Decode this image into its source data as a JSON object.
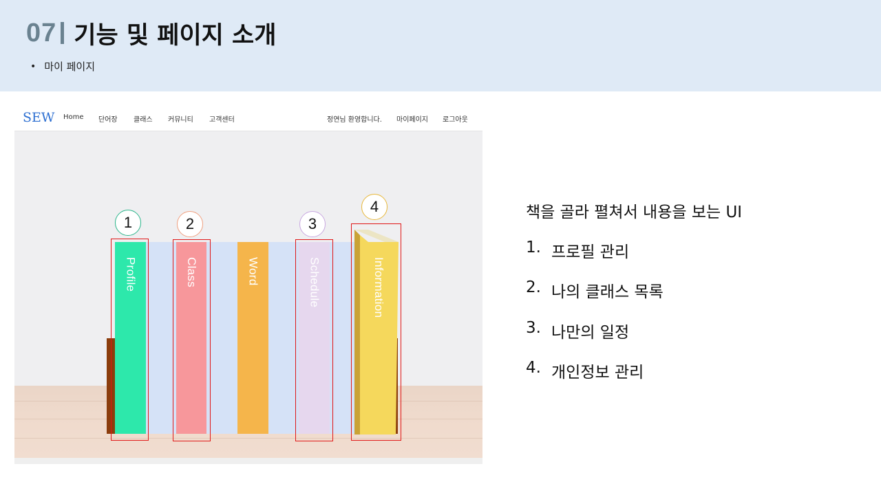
{
  "slide": {
    "number": "07",
    "title": "기능 및 페이지 소개",
    "subtitle": "마이 페이지"
  },
  "screenshot": {
    "logo": "SEW",
    "nav_left": [
      "Home",
      "단어장",
      "클래스",
      "커뮤니티",
      "고객센터"
    ],
    "nav_right": [
      "정연님 환영합니다.",
      "마이페이지",
      "로그아웃"
    ],
    "books": [
      {
        "label": "Profile",
        "color": "#2de8ab"
      },
      {
        "label": "Class",
        "color": "#f7979b"
      },
      {
        "label": "Word",
        "color": "#f5b54b"
      },
      {
        "label": "Schedule",
        "color": "#e6d7ee"
      },
      {
        "label": "Information",
        "color": "#f5d85c"
      }
    ],
    "markers": [
      {
        "number": "1",
        "color": "#2ab58a"
      },
      {
        "number": "2",
        "color": "#f0a080"
      },
      {
        "number": "3",
        "color": "#c9a8e0"
      },
      {
        "number": "4",
        "color": "#e8b83a"
      }
    ],
    "highlight_color": "#e01515"
  },
  "description": {
    "heading": "책을 골라 펼쳐서 내용을 보는 UI",
    "items": [
      {
        "number": "1.",
        "text": "프로필 관리"
      },
      {
        "number": "2.",
        "text": "나의 클래스 목록"
      },
      {
        "number": "3.",
        "text": "나만의 일정"
      },
      {
        "number": "4.",
        "text": "개인정보 관리"
      }
    ]
  }
}
